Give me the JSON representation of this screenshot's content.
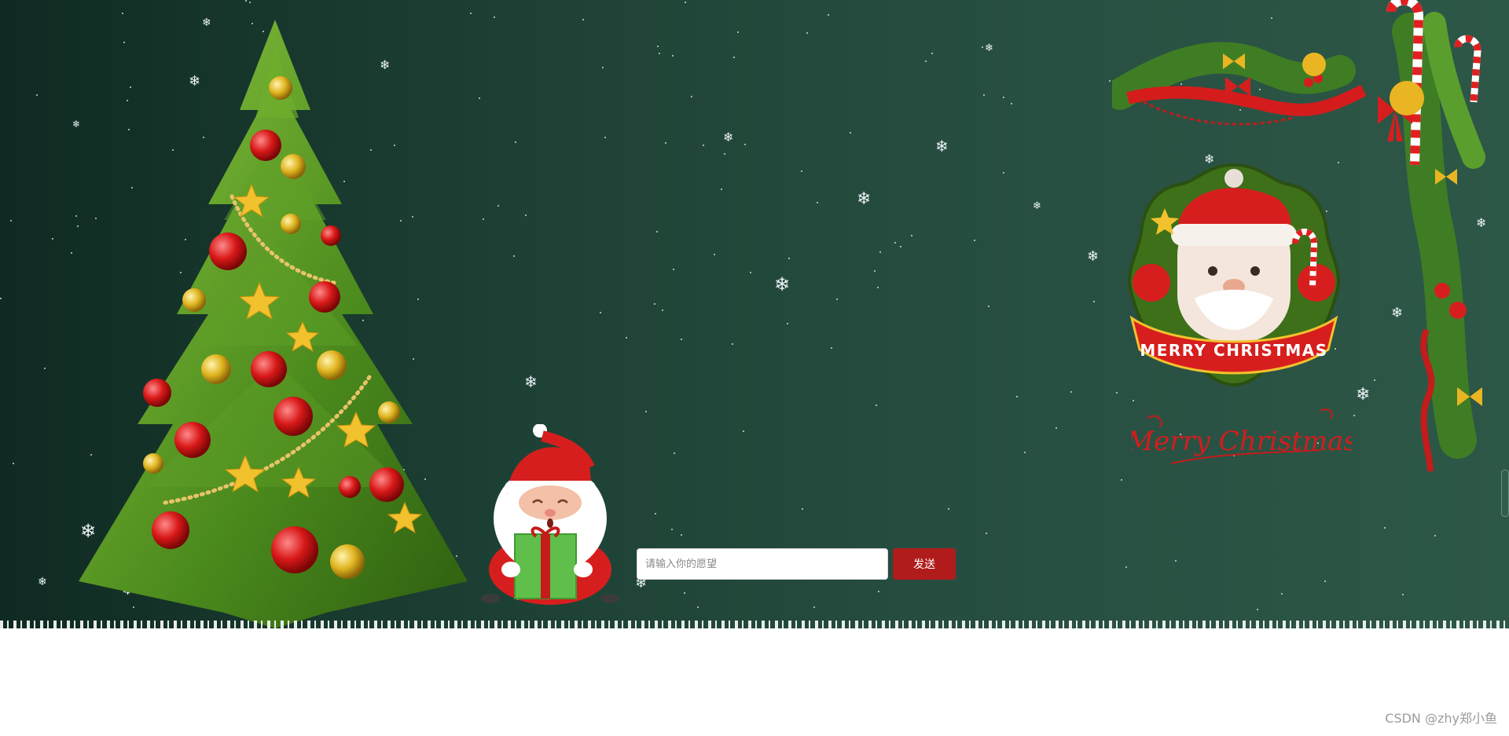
{
  "form": {
    "placeholder": "请输入你的愿望",
    "send_label": "发送"
  },
  "badge": {
    "banner_text": "MERRY CHRISTMAS"
  },
  "script_title": "Merry Christmas",
  "watermark": "CSDN @zhy郑小鱼",
  "colors": {
    "background_dark": "#0f2a22",
    "background_light": "#2d5747",
    "accent_red": "#b01c1c",
    "footer_band": "#ae1c1c"
  }
}
